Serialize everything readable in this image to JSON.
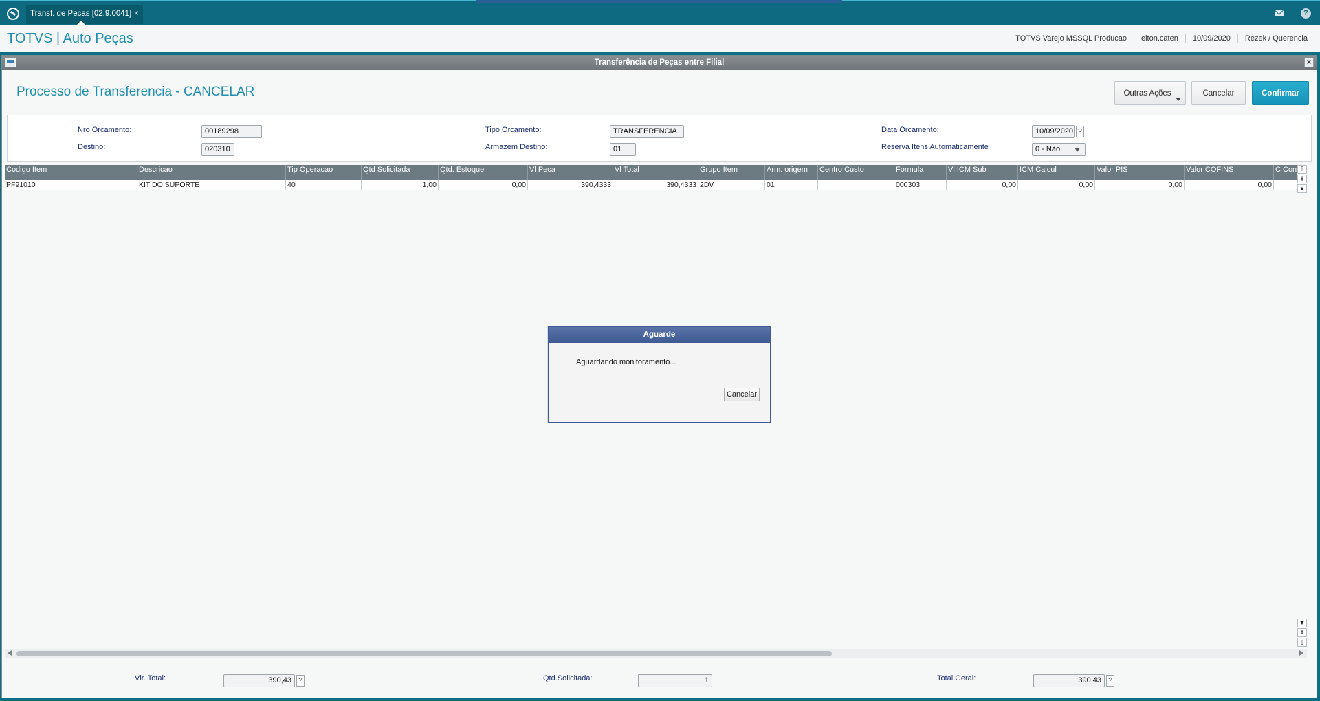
{
  "app_tab": {
    "label": "Transf. de Pecas [02.9.0041]",
    "close": "×"
  },
  "header": {
    "brand": "TOTVS | Auto Peças",
    "environment": "TOTVS Varejo MSSQL Producao",
    "user": "elton.caten",
    "date": "10/09/2020",
    "branch": "Rezek / Querencia"
  },
  "window": {
    "title": "Transferência de Peças entre Filial",
    "close": "×"
  },
  "page": {
    "title": "Processo de Transferencia - CANCELAR"
  },
  "actions": {
    "other": "Outras Ações",
    "cancel": "Cancelar",
    "confirm": "Confirmar"
  },
  "form": {
    "nro_orcamento": {
      "label": "Nro Orcamento:",
      "value": "00189298"
    },
    "destino": {
      "label": "Destino:",
      "value": "020310"
    },
    "tipo_orcamento": {
      "label": "Tipo Orcamento:",
      "value": "TRANSFERENCIA"
    },
    "armazem_destino": {
      "label": "Armazem Destino:",
      "value": "01"
    },
    "data_orcamento": {
      "label": "Data Orcamento:",
      "value": "10/09/2020"
    },
    "reserva": {
      "label": "Reserva Itens Automaticamente",
      "value": "0 - Não"
    },
    "help": "?"
  },
  "grid": {
    "columns": [
      "Codigo Item",
      "Descricao",
      "Tip Operacao",
      "Qtd Solicitada",
      "Qtd. Estoque",
      "Vl Peca",
      "Vl Total",
      "Grupo Item",
      "Arm. origem",
      "Centro Custo",
      "Formula",
      "Vl ICM Sub",
      "ICM Calcul",
      "Valor PIS",
      "Valor COFINS",
      "C Contab"
    ],
    "rows": [
      [
        "PF91010",
        "KIT DO SUPORTE",
        "40",
        "1,00",
        "0,00",
        "390,4333",
        "390,4333",
        "2DV",
        "01",
        "",
        "000303",
        "0,00",
        "0,00",
        "0,00",
        "0,00",
        ""
      ]
    ]
  },
  "totals": {
    "vlr_total": {
      "label": "Vlr. Total:",
      "value": "390,43"
    },
    "qtd_solicitada": {
      "label": "Qtd.Solicitada:",
      "value": "1"
    },
    "total_geral": {
      "label": "Total Geral:",
      "value": "390,43"
    }
  },
  "modal": {
    "title": "Aguarde",
    "message": "Aguardando monitoramento...",
    "cancel": "Cancelar"
  }
}
